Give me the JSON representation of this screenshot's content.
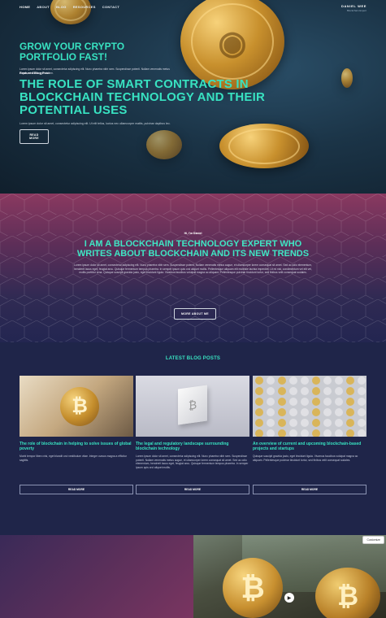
{
  "nav": {
    "items": [
      "HOME",
      "ABOUT",
      "BLOG",
      "RESOURCES",
      "CONTACT"
    ]
  },
  "brand": {
    "name": "DANIEL WEE",
    "tagline": "Blockchain Expert"
  },
  "hero": {
    "label": "Featured Blog Post",
    "title": "THE ROLE OF SMART CONTRACTS IN BLOCKCHAIN TECHNOLOGY AND THEIR POTENTIAL USES",
    "desc": "Lorem ipsum dolor sit amet, consectetur adipiscing elit. Ut elit tellus, luctus nec ullamcorper mattis, pulvinar dapibus leo.",
    "button": "READ MORE"
  },
  "about": {
    "hi": "Hi, I'm Daniel",
    "title": "I AM A BLOCKCHAIN TECHNOLOGY EXPERT WHO WRITES ABOUT BLOCKCHAIN AND ITS NEW TRENDS",
    "desc": "Lorem ipsum dolor sit amet, consectetur adipiscing elit. Nunc pharetra nibh sem. Suspendisse potenti. Nullam venenatis metus augue, et ullamcorper lorem consequat sit amet. Sed ac odio elementum, hendrerit lacus eget, feugiat arcu. Quisque fermentum tempus pharetra. In semper ipsum quis orci aliquet mollis. Pellentesque aliquam elit molestie lacinia imperdiet. Ut mi nisl, condimentum vel elit vel, mollis porttitor urna. Quisque suscipit gravida justo, eget tincidunt ligula. Vivamus faucibus volutpat magna ac aliquam. Pellentesque pulvinar tincidunt tortor, sed finibus velit consequat sodales.",
    "button": "MORE ABOUT ME"
  },
  "latest": {
    "heading": "LATEST BLOG POSTS",
    "posts": [
      {
        "title": "The role of blockchain in helping to solve issues of global poverty",
        "excerpt": "Morbi tempor libero nisi, eget blandit orci vestibulum vitae. Integer cursus magna a efficitur sagittis.",
        "button": "READ MORE"
      },
      {
        "title": "The legal and regulatory landscape surrounding blockchain technology",
        "excerpt": "Lorem ipsum dolor sit amet, consectetur adipiscing elit. Nunc pharetra nibh sem. Suspendisse potenti. Nullam venenatis metus augue, et ullamcorper lorem consequat sit amet. Sed ac odio elementum, hendrerit lacus eget, feugiat arcu. Quisque fermentum tempus pharetra. In semper ipsum quis orci aliquet mollis.",
        "button": "READ MORE"
      },
      {
        "title": "An overview of current and upcoming blockchain-based projects and startups",
        "excerpt": "Quisque suscipit gravida justo, eget tincidunt ligula. Vivamus faucibus volutpat magna ac aliquam. Pellentesque pulvinar tincidunt tortor, sed finibus velit consequat sodales.",
        "button": "READ MORE"
      }
    ]
  },
  "grow": {
    "title_line1": "GROW YOUR CRYPTO",
    "title_line2": "PORTFOLIO FAST!",
    "desc": "Lorem ipsum dolor sit amet, consectetur adipiscing elit. Nunc pharetra nibh sem. Suspendisse potenti. Nullam venenatis metus augue, et ullamcorper lorem."
  },
  "customize": "Customize",
  "colors": {
    "accent": "#38e2c1",
    "hero_bg": "#16293a",
    "page_bg": "#1f2549"
  }
}
